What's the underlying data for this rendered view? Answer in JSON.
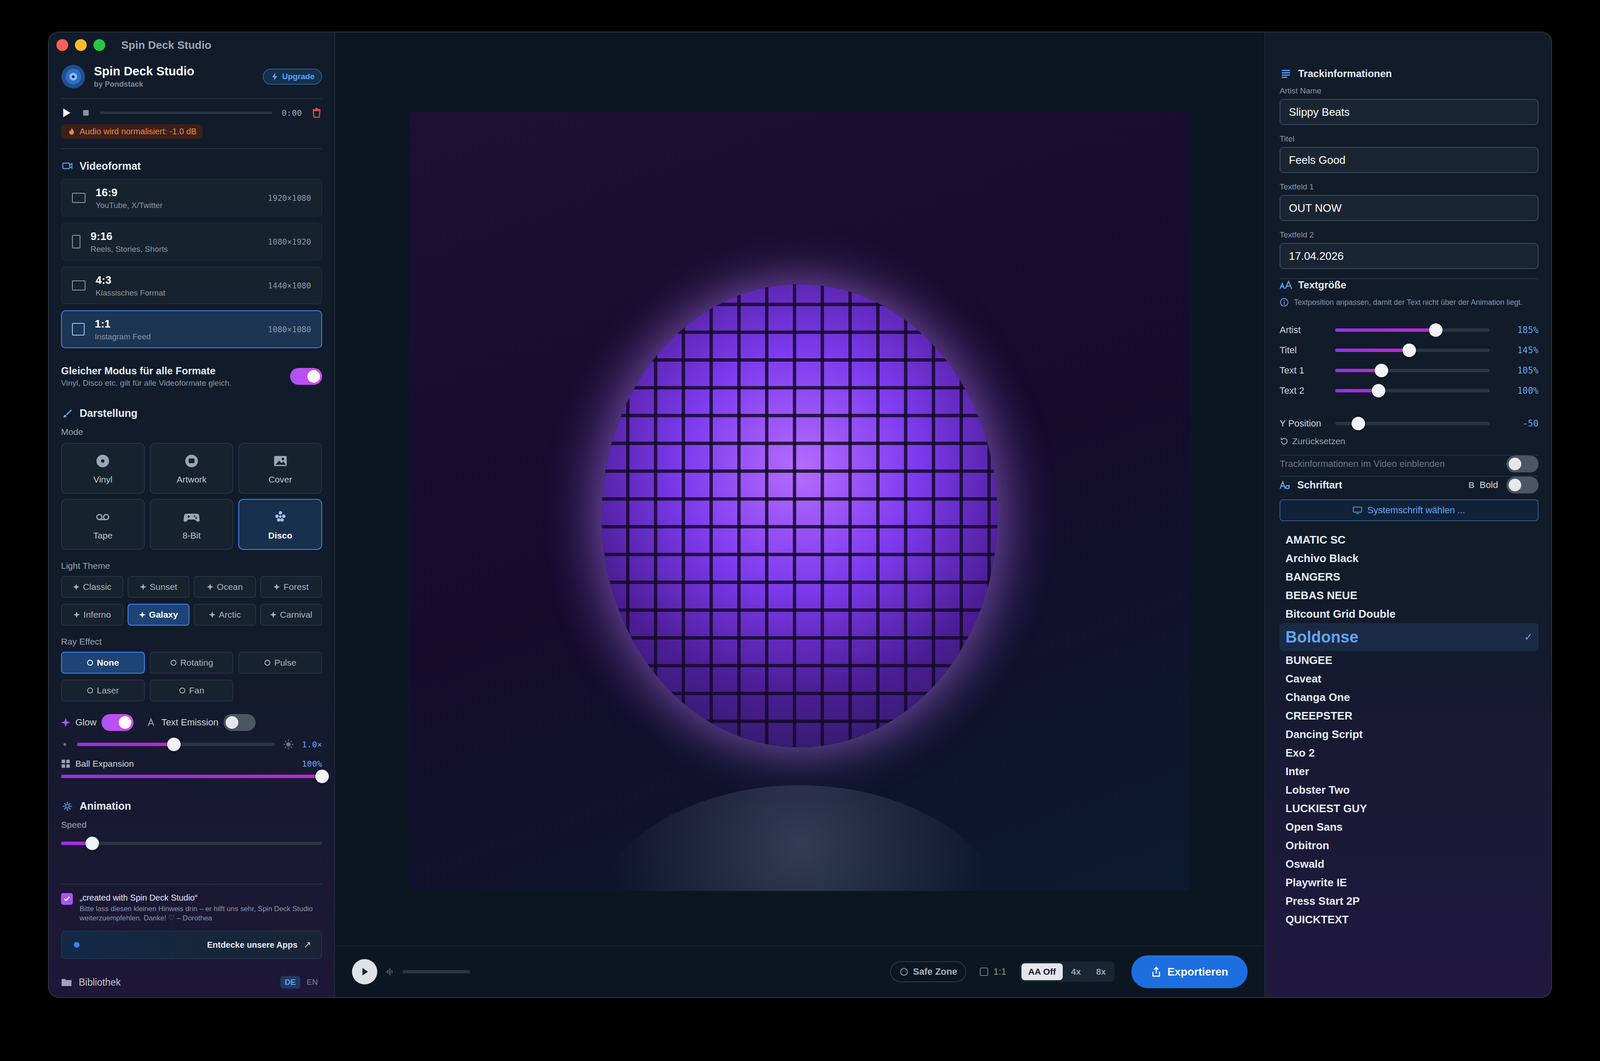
{
  "window": {
    "title": "Spin Deck Studio"
  },
  "sidebar": {
    "app": {
      "name": "Spin Deck Studio",
      "byline": "by Pondstack",
      "upgrade": "Upgrade"
    },
    "player": {
      "time": "0:00",
      "level": 0,
      "playing": false
    },
    "normalize_badge": "Audio wird normalisiert: -1.0 dB",
    "video_format": {
      "title": "Videoformat",
      "formats": [
        {
          "ratio": "16:9",
          "use": "YouTube, X/Twitter",
          "resolution": "1920×1080",
          "selected": false,
          "portrait": false
        },
        {
          "ratio": "9:16",
          "use": "Reels, Stories, Shorts",
          "resolution": "1080×1920",
          "selected": false,
          "portrait": true
        },
        {
          "ratio": "4:3",
          "use": "Klassisches Format",
          "resolution": "1440×1080",
          "selected": false,
          "portrait": false
        },
        {
          "ratio": "1:1",
          "use": "Instagram Feed",
          "resolution": "1080×1080",
          "selected": true,
          "portrait": false
        }
      ]
    },
    "same_mode": {
      "label": "Gleicher Modus für alle Formate",
      "hint": "Vinyl, Disco etc. gilt für alle Videoformate gleich.",
      "on": true
    },
    "appearance": {
      "title": "Darstellung",
      "mode_label": "Mode",
      "modes": [
        {
          "label": "Vinyl",
          "selected": false
        },
        {
          "label": "Artwork",
          "selected": false
        },
        {
          "label": "Cover",
          "selected": false
        },
        {
          "label": "Tape",
          "selected": false
        },
        {
          "label": "8-Bit",
          "selected": false
        },
        {
          "label": "Disco",
          "selected": true
        }
      ],
      "light_theme_label": "Light Theme",
      "themes": [
        {
          "label": "Classic",
          "selected": false
        },
        {
          "label": "Sunset",
          "selected": false
        },
        {
          "label": "Ocean",
          "selected": false
        },
        {
          "label": "Forest",
          "selected": false
        },
        {
          "label": "Inferno",
          "selected": false
        },
        {
          "label": "Galaxy",
          "selected": true
        },
        {
          "label": "Arctic",
          "selected": false
        },
        {
          "label": "Carnival",
          "selected": false
        }
      ],
      "ray_label": "Ray Effect",
      "rays": [
        {
          "label": "None",
          "selected": true
        },
        {
          "label": "Rotating",
          "selected": false
        },
        {
          "label": "Pulse",
          "selected": false
        },
        {
          "label": "Laser",
          "selected": false
        },
        {
          "label": "Fan",
          "selected": false
        }
      ],
      "glow": {
        "label": "Glow",
        "on": true,
        "level": 0.49,
        "reading": "1.0×"
      },
      "text_emission": {
        "label": "Text Emission",
        "on": false
      },
      "ball_expansion": {
        "label": "Ball Expansion",
        "reading": "100%",
        "level": 1
      }
    },
    "animation": {
      "title": "Animation",
      "speed_label": "Speed",
      "level": 0.12
    },
    "credit": {
      "label": "„created with Spin Deck Studio“",
      "note": "Bitte lass diesen kleinen Hinweis drin – er hilft uns sehr, Spin Deck Studio weiterzuempfehlen. Danke! ♡ – Dorothea",
      "checked": true
    },
    "discover": {
      "label": "Entdecke unsere Apps",
      "arrow": "↗"
    },
    "footer": {
      "library": "Bibliothek",
      "languages": [
        {
          "label": "DE",
          "selected": true
        },
        {
          "label": "EN",
          "selected": false
        }
      ]
    }
  },
  "toolbar": {
    "playing": false,
    "level": 0,
    "safe_zone": "Safe Zone",
    "ratio_lock": {
      "label": "1:1",
      "checked": false
    },
    "antialias": [
      {
        "label": "AA Off",
        "selected": true
      },
      {
        "label": "4x",
        "selected": false
      },
      {
        "label": "8x",
        "selected": false
      }
    ],
    "export": "Exportieren"
  },
  "track_panel": {
    "title": "Trackinformationen",
    "fields": [
      {
        "label": "Artist Name",
        "value": "Slippy Beats"
      },
      {
        "label": "Titel",
        "value": "Feels Good"
      },
      {
        "label": "Textfeld 1",
        "value": "OUT NOW"
      },
      {
        "label": "Textfeld 2",
        "value": "17.04.2026"
      }
    ],
    "text_size": {
      "title": "Textgröße",
      "info": "Textposition anpassen, damit der Text nicht über der Animation liegt.",
      "sliders": [
        {
          "label": "Artist",
          "reading": "185%",
          "level": 0.65
        },
        {
          "label": "Titel",
          "reading": "145%",
          "level": 0.48
        },
        {
          "label": "Text 1",
          "reading": "105%",
          "level": 0.3
        },
        {
          "label": "Text 2",
          "reading": "100%",
          "level": 0.28
        }
      ],
      "y_position": {
        "label": "Y Position",
        "reading": "-50",
        "level": 0.15
      },
      "reset": "Zurücksetzen"
    },
    "show_in_video": {
      "label": "Trackinformationen im Video einblenden",
      "on": false,
      "disabled": true
    },
    "font": {
      "title": "Schriftart",
      "bold_icon": "B",
      "bold_label": "Bold",
      "bold_on": false,
      "system_button": "Systemschrift wählen ...",
      "check_mark": "✓",
      "fonts": [
        {
          "name": "AMATIC SC",
          "selected": false
        },
        {
          "name": "Archivo Black",
          "selected": false
        },
        {
          "name": "BANGERS",
          "selected": false
        },
        {
          "name": "BEBAS NEUE",
          "selected": false
        },
        {
          "name": "Bitcount Grid Double",
          "selected": false
        },
        {
          "name": "Boldonse",
          "selected": true
        },
        {
          "name": "BUNGEE",
          "selected": false
        },
        {
          "name": "Caveat",
          "selected": false
        },
        {
          "name": "Changa One",
          "selected": false
        },
        {
          "name": "CREEPSTER",
          "selected": false
        },
        {
          "name": "Dancing Script",
          "selected": false
        },
        {
          "name": "Exo 2",
          "selected": false
        },
        {
          "name": "Inter",
          "selected": false
        },
        {
          "name": "Lobster Two",
          "selected": false
        },
        {
          "name": "LUCKIEST GUY",
          "selected": false
        },
        {
          "name": "Open Sans",
          "selected": false
        },
        {
          "name": "Orbitron",
          "selected": false
        },
        {
          "name": "Oswald",
          "selected": false
        },
        {
          "name": "Playwrite IE",
          "selected": false
        },
        {
          "name": "Press Start 2P",
          "selected": false
        },
        {
          "name": "QUICKTEXT",
          "selected": false
        }
      ]
    }
  }
}
